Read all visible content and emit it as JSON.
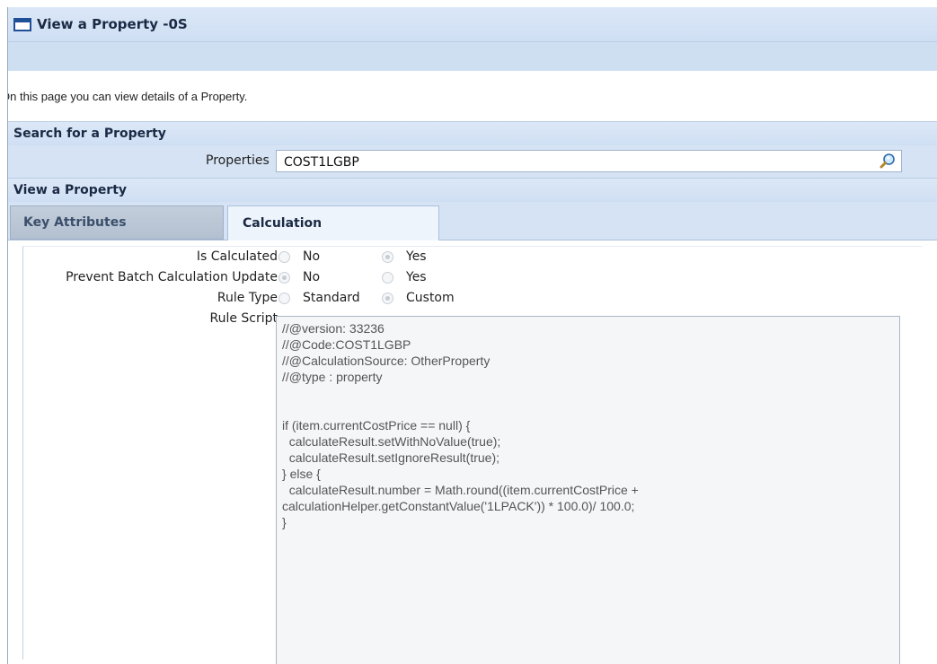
{
  "window": {
    "title": "View a Property - ",
    "title_suffix": "0S"
  },
  "intro_text": "On this page you can view details of a Property.",
  "search_section": {
    "header": "Search for a Property",
    "label": "Properties",
    "value": "COST1LGBP",
    "icon": "search-icon"
  },
  "view_section": {
    "header": "View a Property"
  },
  "tabs": [
    {
      "label": "Key Attributes",
      "active": false
    },
    {
      "label": "Calculation",
      "active": true
    }
  ],
  "form": {
    "is_calculated": {
      "label": "Is Calculated",
      "options": [
        {
          "label": "No",
          "checked": false
        },
        {
          "label": "Yes",
          "checked": true
        }
      ]
    },
    "prevent_batch": {
      "label": "Prevent Batch Calculation Update",
      "options": [
        {
          "label": "No",
          "checked": true
        },
        {
          "label": "Yes",
          "checked": false
        }
      ]
    },
    "rule_type": {
      "label": "Rule Type",
      "options": [
        {
          "label": "Standard",
          "checked": false
        },
        {
          "label": "Custom",
          "checked": true
        }
      ]
    },
    "rule_script": {
      "label": "Rule Script",
      "value": "//@version: 33236\n//@Code:COST1LGBP\n//@CalculationSource: OtherProperty\n//@type : property\n\n\nif (item.currentCostPrice == null) {\n  calculateResult.setWithNoValue(true);\n  calculateResult.setIgnoreResult(true);\n} else {\n  calculateResult.number = Math.round((item.currentCostPrice +\ncalculationHelper.getConstantValue('1LPACK')) * 100.0)/ 100.0;\n}"
    }
  }
}
